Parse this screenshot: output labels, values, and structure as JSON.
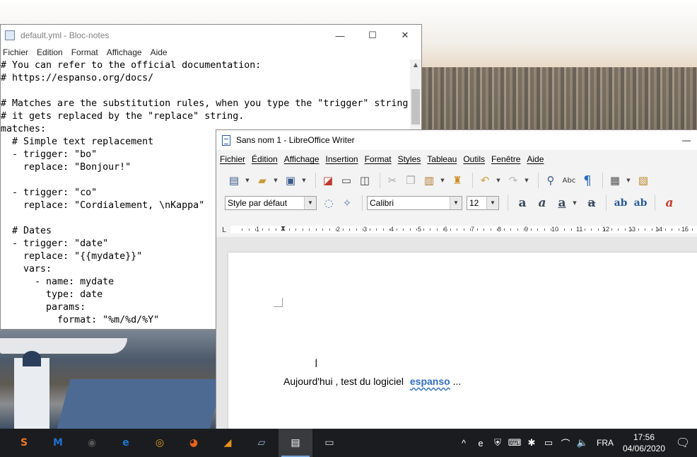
{
  "notepad": {
    "title": "default.yml - Bloc-notes",
    "window_controls": [
      "—",
      "☐",
      "✕"
    ],
    "menu": [
      "Fichier",
      "Edition",
      "Format",
      "Affichage",
      "Aide"
    ],
    "lines": [
      "# You can refer to the official documentation:",
      "# https://espanso.org/docs/",
      "",
      "# Matches are the substitution rules, when you type the \"trigger\" string",
      "# it gets replaced by the \"replace\" string.",
      "matches:",
      "  # Simple text replacement",
      "  - trigger: \"bo\"",
      "    replace: \"Bonjour!\"",
      "",
      "  - trigger: \"co\"",
      "    replace: \"Cordialement, \\nKappa\"",
      "",
      "  # Dates",
      "  - trigger: \"date\"",
      "    replace: \"{{mydate}}\"",
      "    vars:",
      "      - name: mydate",
      "        type: date",
      "        params:",
      "          format: \"%m/%d/%Y\""
    ]
  },
  "writer": {
    "title": "Sans nom 1 - LibreOffice Writer",
    "minimize": "—",
    "menu": [
      "Fichier",
      "Édition",
      "Affichage",
      "Insertion",
      "Format",
      "Styles",
      "Tableau",
      "Outils",
      "Fenêtre",
      "Aide"
    ],
    "paragraph_style": "Style par défaut",
    "font_name": "Calibri",
    "font_size": "12",
    "ruler_numbers": [
      "1",
      "1",
      "2",
      "3",
      "4",
      "5",
      "6",
      "7",
      "8",
      "9",
      "10",
      "11",
      "12",
      "13",
      "14",
      "15"
    ],
    "document_text": "Aujourd'hui , test du logiciel",
    "document_highlight": "espanso",
    "document_tail": "...",
    "toolbar_icons": [
      "new-document-icon",
      "open-folder-icon",
      "save-icon",
      "export-pdf-icon",
      "print-icon",
      "print-preview-icon",
      "cut-icon",
      "copy-icon",
      "paste-icon",
      "clone-formatting-icon",
      "undo-icon",
      "redo-icon",
      "find-replace-icon",
      "spelling-icon",
      "formatting-marks-icon",
      "insert-table-icon",
      "insert-image-icon"
    ],
    "format_glyphs": {
      "bold": "a",
      "italic": "a",
      "underline": "a",
      "strike": "a",
      "superscript": "ab",
      "subscript": "ab",
      "clear": "a"
    },
    "ruler_left": "L",
    "ruler_indent": "⧗"
  },
  "taskbar": {
    "apps": [
      {
        "name": "sonic-app-icon",
        "glyph": "S",
        "color": "#f07820"
      },
      {
        "name": "malwarebytes-icon",
        "glyph": "M",
        "color": "#1f6fd1"
      },
      {
        "name": "webcam-app-icon",
        "glyph": "◉",
        "color": "#555555"
      },
      {
        "name": "edge-icon",
        "glyph": "e",
        "color": "#1e78d0"
      },
      {
        "name": "chrome-icon",
        "glyph": "◎",
        "color": "#e0a020"
      },
      {
        "name": "firefox-icon",
        "glyph": "◕",
        "color": "#e8621c"
      },
      {
        "name": "sublime-text-icon",
        "glyph": "◢",
        "color": "#e8941a"
      },
      {
        "name": "notepad-taskbar-icon",
        "glyph": "▱",
        "color": "#9ab8d8"
      },
      {
        "name": "writer-taskbar-icon",
        "glyph": "▤",
        "color": "#ffffff"
      },
      {
        "name": "display-app-icon",
        "glyph": "▭",
        "color": "#dddddd"
      }
    ],
    "tray_icons": [
      "^",
      "e",
      "⛨",
      "⌨",
      "✱",
      "▭",
      "⌒",
      "🔈"
    ],
    "language": "FRA",
    "time": "17:56",
    "date": "04/06/2020",
    "notification_glyph": "🗨"
  }
}
